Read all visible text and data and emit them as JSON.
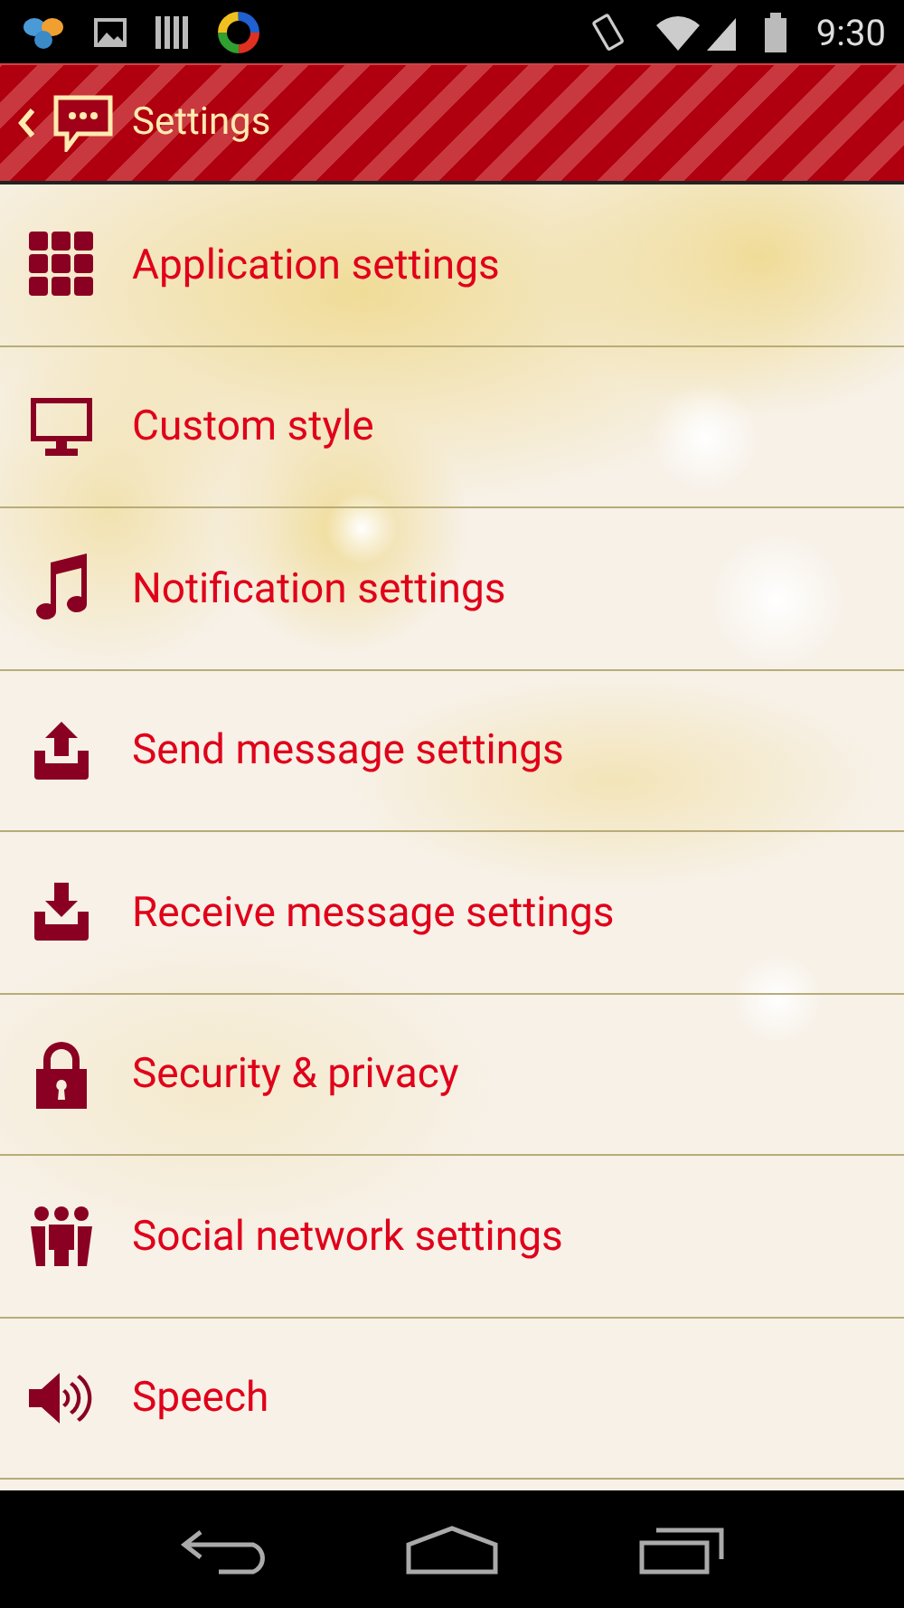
{
  "status_bar": {
    "time": "9:30"
  },
  "header": {
    "title": "Settings"
  },
  "items": [
    {
      "label": "Application settings"
    },
    {
      "label": "Custom style"
    },
    {
      "label": "Notification settings"
    },
    {
      "label": "Send message settings"
    },
    {
      "label": "Receive message settings"
    },
    {
      "label": "Security & privacy"
    },
    {
      "label": "Social network settings"
    },
    {
      "label": "Speech"
    }
  ]
}
